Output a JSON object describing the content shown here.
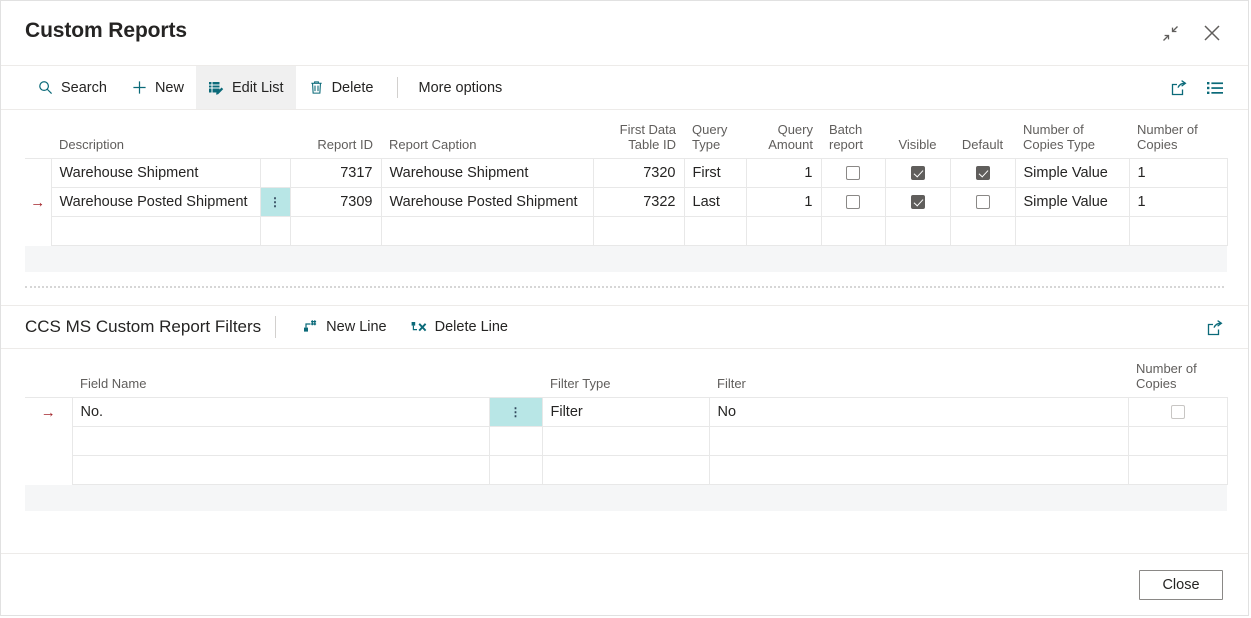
{
  "window": {
    "title": "Custom Reports",
    "minimize_icon": "shrink-icon",
    "close_icon": "close-icon"
  },
  "toolbar": {
    "items": [
      {
        "label": "Search",
        "icon": "search-icon",
        "active": false
      },
      {
        "label": "New",
        "icon": "plus-icon",
        "active": false
      },
      {
        "label": "Edit List",
        "icon": "edit-list-icon",
        "active": true
      },
      {
        "label": "Delete",
        "icon": "trash-icon",
        "active": false
      }
    ],
    "more_options": "More options",
    "right_icons": [
      "share-icon",
      "list-view-icon"
    ]
  },
  "main_grid": {
    "columns": [
      {
        "key": "indicator",
        "label": ""
      },
      {
        "key": "description",
        "label": "Description"
      },
      {
        "key": "dots",
        "label": ""
      },
      {
        "key": "report_id",
        "label": "Report ID"
      },
      {
        "key": "report_caption",
        "label": "Report Caption"
      },
      {
        "key": "first_data_table_id",
        "label": "First Data Table ID"
      },
      {
        "key": "query_type",
        "label": "Query Type"
      },
      {
        "key": "query_amount",
        "label": "Query Amount"
      },
      {
        "key": "batch_report",
        "label": "Batch report"
      },
      {
        "key": "visible",
        "label": "Visible"
      },
      {
        "key": "default",
        "label": "Default"
      },
      {
        "key": "number_of_copies_type",
        "label": "Number of Copies Type"
      },
      {
        "key": "number_of_copies",
        "label": "Number of Copies"
      }
    ],
    "rows": [
      {
        "selected": false,
        "description": "Warehouse Shipment",
        "report_id": "7317",
        "report_caption": "Warehouse Shipment",
        "first_data_table_id": "7320",
        "query_type": "First",
        "query_amount": "1",
        "batch_report": false,
        "visible": true,
        "default": true,
        "number_of_copies_type": "Simple Value",
        "number_of_copies": "1"
      },
      {
        "selected": true,
        "description": "Warehouse Posted Shipment",
        "report_id": "7309",
        "report_caption": "Warehouse Posted Shipment",
        "first_data_table_id": "7322",
        "query_type": "Last",
        "query_amount": "1",
        "batch_report": false,
        "visible": true,
        "default": false,
        "number_of_copies_type": "Simple Value",
        "number_of_copies": "1"
      }
    ],
    "row_indicator_glyph": "→",
    "dots_glyph": "⋮"
  },
  "subpart": {
    "title": "CCS MS Custom Report Filters",
    "actions": [
      {
        "label": "New Line",
        "icon": "new-line-icon"
      },
      {
        "label": "Delete Line",
        "icon": "delete-line-icon"
      }
    ],
    "right_icons": [
      "share-icon"
    ],
    "columns": [
      {
        "key": "indicator",
        "label": ""
      },
      {
        "key": "field_name",
        "label": "Field Name"
      },
      {
        "key": "dots",
        "label": ""
      },
      {
        "key": "filter_type",
        "label": "Filter Type"
      },
      {
        "key": "filter",
        "label": "Filter"
      },
      {
        "key": "number_of_copies",
        "label": "Number of Copies"
      }
    ],
    "rows": [
      {
        "selected": true,
        "field_name": "No.",
        "filter_type": "Filter",
        "filter": "No",
        "number_of_copies": false
      }
    ]
  },
  "footer": {
    "close_label": "Close"
  },
  "colors": {
    "accent_teal": "#0b6a79",
    "selected_cell": "#b8e6e6",
    "grid_line": "#e8e8e8",
    "footer_band": "#f5f6f7"
  }
}
